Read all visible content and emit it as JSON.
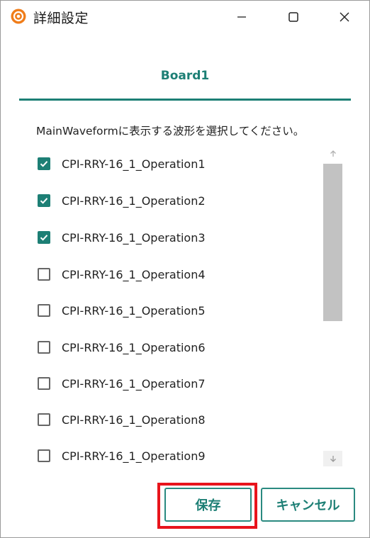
{
  "window": {
    "title": "詳細設定",
    "app_icon": "orange-gear-icon",
    "controls": {
      "minimize": "minimize-icon",
      "maximize": "maximize-icon",
      "close": "close-icon"
    }
  },
  "tab": {
    "label": "Board1"
  },
  "instruction": "MainWaveformに表示する波形を選択してください。",
  "waveforms": [
    {
      "label": "CPI-RRY-16_1_Operation1",
      "checked": true
    },
    {
      "label": "CPI-RRY-16_1_Operation2",
      "checked": true
    },
    {
      "label": "CPI-RRY-16_1_Operation3",
      "checked": true
    },
    {
      "label": "CPI-RRY-16_1_Operation4",
      "checked": false
    },
    {
      "label": "CPI-RRY-16_1_Operation5",
      "checked": false
    },
    {
      "label": "CPI-RRY-16_1_Operation6",
      "checked": false
    },
    {
      "label": "CPI-RRY-16_1_Operation7",
      "checked": false
    },
    {
      "label": "CPI-RRY-16_1_Operation8",
      "checked": false
    },
    {
      "label": "CPI-RRY-16_1_Operation9",
      "checked": false
    }
  ],
  "buttons": {
    "save": "保存",
    "cancel": "キャンセル"
  },
  "colors": {
    "accent": "#1d7f75",
    "highlight": "#e8141c",
    "app_icon": "#f07d1a"
  }
}
